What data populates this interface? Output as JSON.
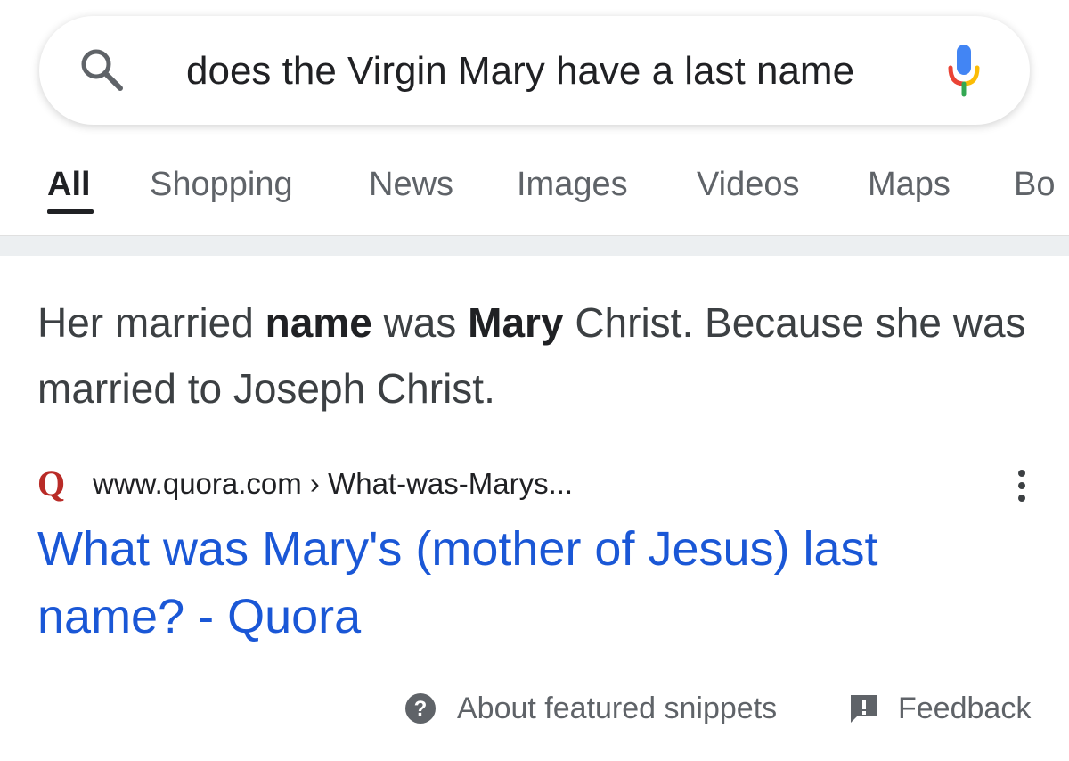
{
  "search": {
    "query": "does the Virgin Mary have a last name",
    "search_icon": "search-icon",
    "mic_icon": "microphone-icon"
  },
  "tabs": [
    {
      "label": "All",
      "active": true
    },
    {
      "label": "Shopping",
      "active": false
    },
    {
      "label": "News",
      "active": false
    },
    {
      "label": "Images",
      "active": false
    },
    {
      "label": "Videos",
      "active": false
    },
    {
      "label": "Maps",
      "active": false
    },
    {
      "label": "Bo",
      "active": false
    }
  ],
  "snippet": {
    "text_1": "Her married ",
    "bold_1": "name",
    "text_2": " was ",
    "bold_2": "Mary",
    "text_3": " Christ. Because she was married to Joseph Christ."
  },
  "result": {
    "source_logo": "Q",
    "url": "www.quora.com › What-was-Marys...",
    "title": "What was Mary's (mother of Jesus) last name? - Quora",
    "more_icon": "more-vert-icon"
  },
  "footer": {
    "about_label": "About featured snippets",
    "feedback_label": "Feedback"
  },
  "colors": {
    "link": "#1a57d6",
    "quora": "#b92b27",
    "mic_blue": "#4285f4",
    "mic_red": "#ea4335",
    "mic_yellow": "#fbbc05",
    "mic_green": "#34a853"
  }
}
